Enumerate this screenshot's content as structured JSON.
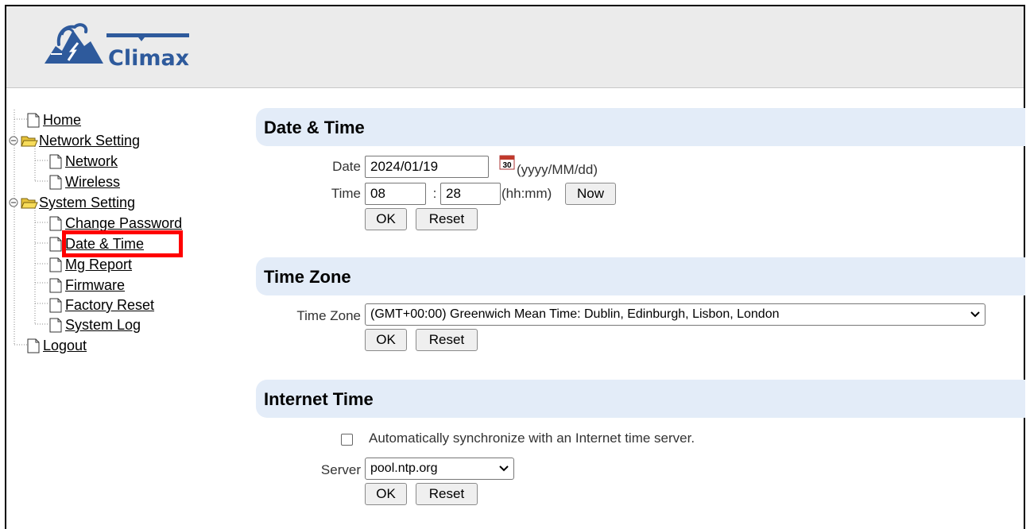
{
  "header": {
    "brand": "Climax"
  },
  "sidebar": {
    "items": [
      {
        "label": "Home"
      },
      {
        "label": "Network Setting"
      },
      {
        "label": "Network"
      },
      {
        "label": "Wireless"
      },
      {
        "label": "System Setting"
      },
      {
        "label": "Change Password"
      },
      {
        "label": "Date & Time"
      },
      {
        "label": "Mg Report"
      },
      {
        "label": "Firmware"
      },
      {
        "label": "Factory Reset"
      },
      {
        "label": "System Log"
      },
      {
        "label": "Logout"
      }
    ]
  },
  "date_time": {
    "title": "Date & Time",
    "date_label": "Date",
    "date_value": "2024/01/19",
    "calendar_icon_text": "30",
    "date_format": "(yyyy/MM/dd)",
    "time_label": "Time",
    "hour_value": "08",
    "separator": ":",
    "minute_value": "28",
    "time_format": "(hh:mm)",
    "now_label": "Now",
    "ok_label": "OK",
    "reset_label": "Reset"
  },
  "time_zone": {
    "title": "Time Zone",
    "label": "Time Zone",
    "selected": "(GMT+00:00) Greenwich Mean Time: Dublin, Edinburgh, Lisbon, London",
    "ok_label": "OK",
    "reset_label": "Reset"
  },
  "internet_time": {
    "title": "Internet Time",
    "sync_label": "Automatically synchronize with an Internet time server.",
    "sync_checked": false,
    "server_label": "Server",
    "server_selected": "pool.ntp.org",
    "ok_label": "OK",
    "reset_label": "Reset"
  },
  "colors": {
    "header_bg": "#ebebeb",
    "section_bg": "#e3ecf8",
    "brand_blue": "#2e5a9c",
    "highlight": "#ff0000"
  }
}
